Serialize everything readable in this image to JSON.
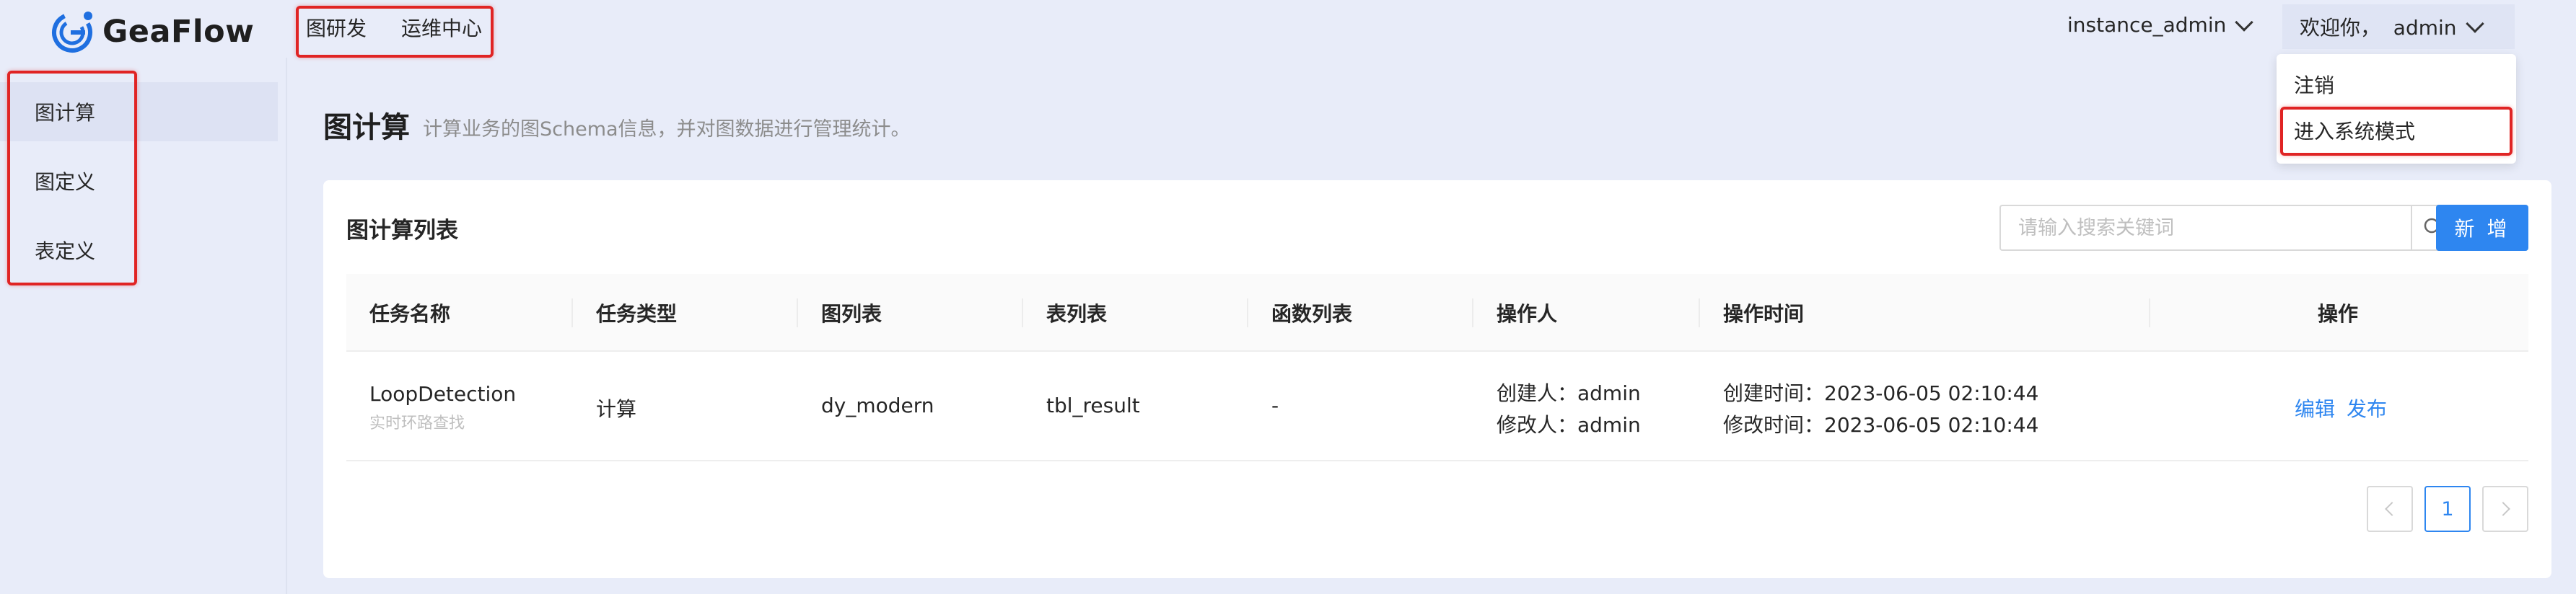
{
  "app": {
    "name": "GeaFlow"
  },
  "topnav": {
    "items": [
      "图研发",
      "运维中心"
    ]
  },
  "header": {
    "instance": "instance_admin",
    "welcome": "欢迎你，  admin"
  },
  "user_menu": {
    "items": [
      "注销",
      "进入系统模式"
    ]
  },
  "sidebar": {
    "items": [
      "图计算",
      "图定义",
      "表定义"
    ]
  },
  "page": {
    "title": "图计算",
    "description": "计算业务的图Schema信息，并对图数据进行管理统计。"
  },
  "card": {
    "title": "图计算列表",
    "search_placeholder": "请输入搜索关键词",
    "add_label": "新 增"
  },
  "table": {
    "columns": [
      "任务名称",
      "任务类型",
      "图列表",
      "表列表",
      "函数列表",
      "操作人",
      "操作时间",
      "操作"
    ],
    "rows": [
      {
        "name": "LoopDetection",
        "desc": "实时环路查找",
        "type": "计算",
        "graphs": "dy_modern",
        "tables": "tbl_result",
        "functions": "-",
        "creator": "创建人：admin",
        "modifier": "修改人：admin",
        "created": "创建时间：2023-06-05 02:10:44",
        "modified": "修改时间：2023-06-05 02:10:44",
        "actions": [
          "编辑",
          "发布"
        ]
      }
    ]
  },
  "pagination": {
    "current": "1"
  },
  "colors": {
    "accent": "#2e86f0",
    "highlight": "#e02424",
    "background": "#e8ecf9"
  }
}
